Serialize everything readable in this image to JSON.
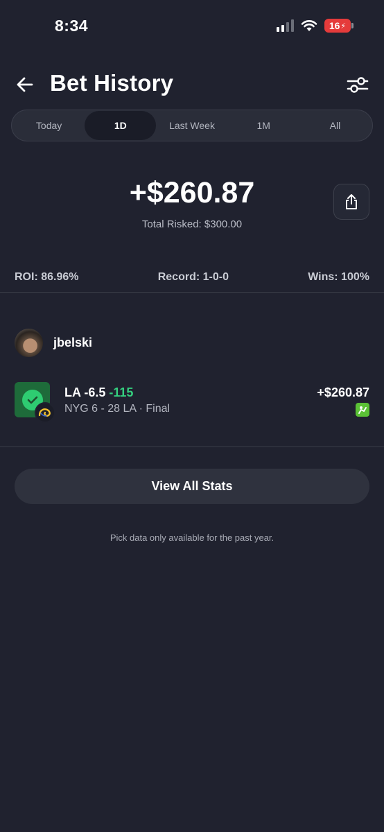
{
  "status_bar": {
    "time": "8:34",
    "battery": "16"
  },
  "header": {
    "title": "Bet History"
  },
  "tabs": [
    {
      "label": "Today",
      "active": false
    },
    {
      "label": "1D",
      "active": true
    },
    {
      "label": "Last Week",
      "active": false
    },
    {
      "label": "1M",
      "active": false
    },
    {
      "label": "All",
      "active": false
    }
  ],
  "summary": {
    "profit": "+$260.87",
    "total_risked": "Total Risked: $300.00"
  },
  "stats": {
    "roi": "ROI: 86.96%",
    "record": "Record: 1-0-0",
    "wins": "Wins: 100%"
  },
  "user": {
    "name": "jbelski"
  },
  "bet": {
    "pick": "LA -6.5",
    "odds": "-115",
    "result": "NYG 6 - 28 LA · Final",
    "amount": "+$260.87",
    "status": "won"
  },
  "actions": {
    "view_all_stats": "View All Stats"
  },
  "footer_note": "Pick data only available for the past year.",
  "colors": {
    "background": "#20222f",
    "win_green": "#35d07f",
    "badge_green": "#1e6b3a",
    "sportsbook_green": "#5bc236"
  }
}
